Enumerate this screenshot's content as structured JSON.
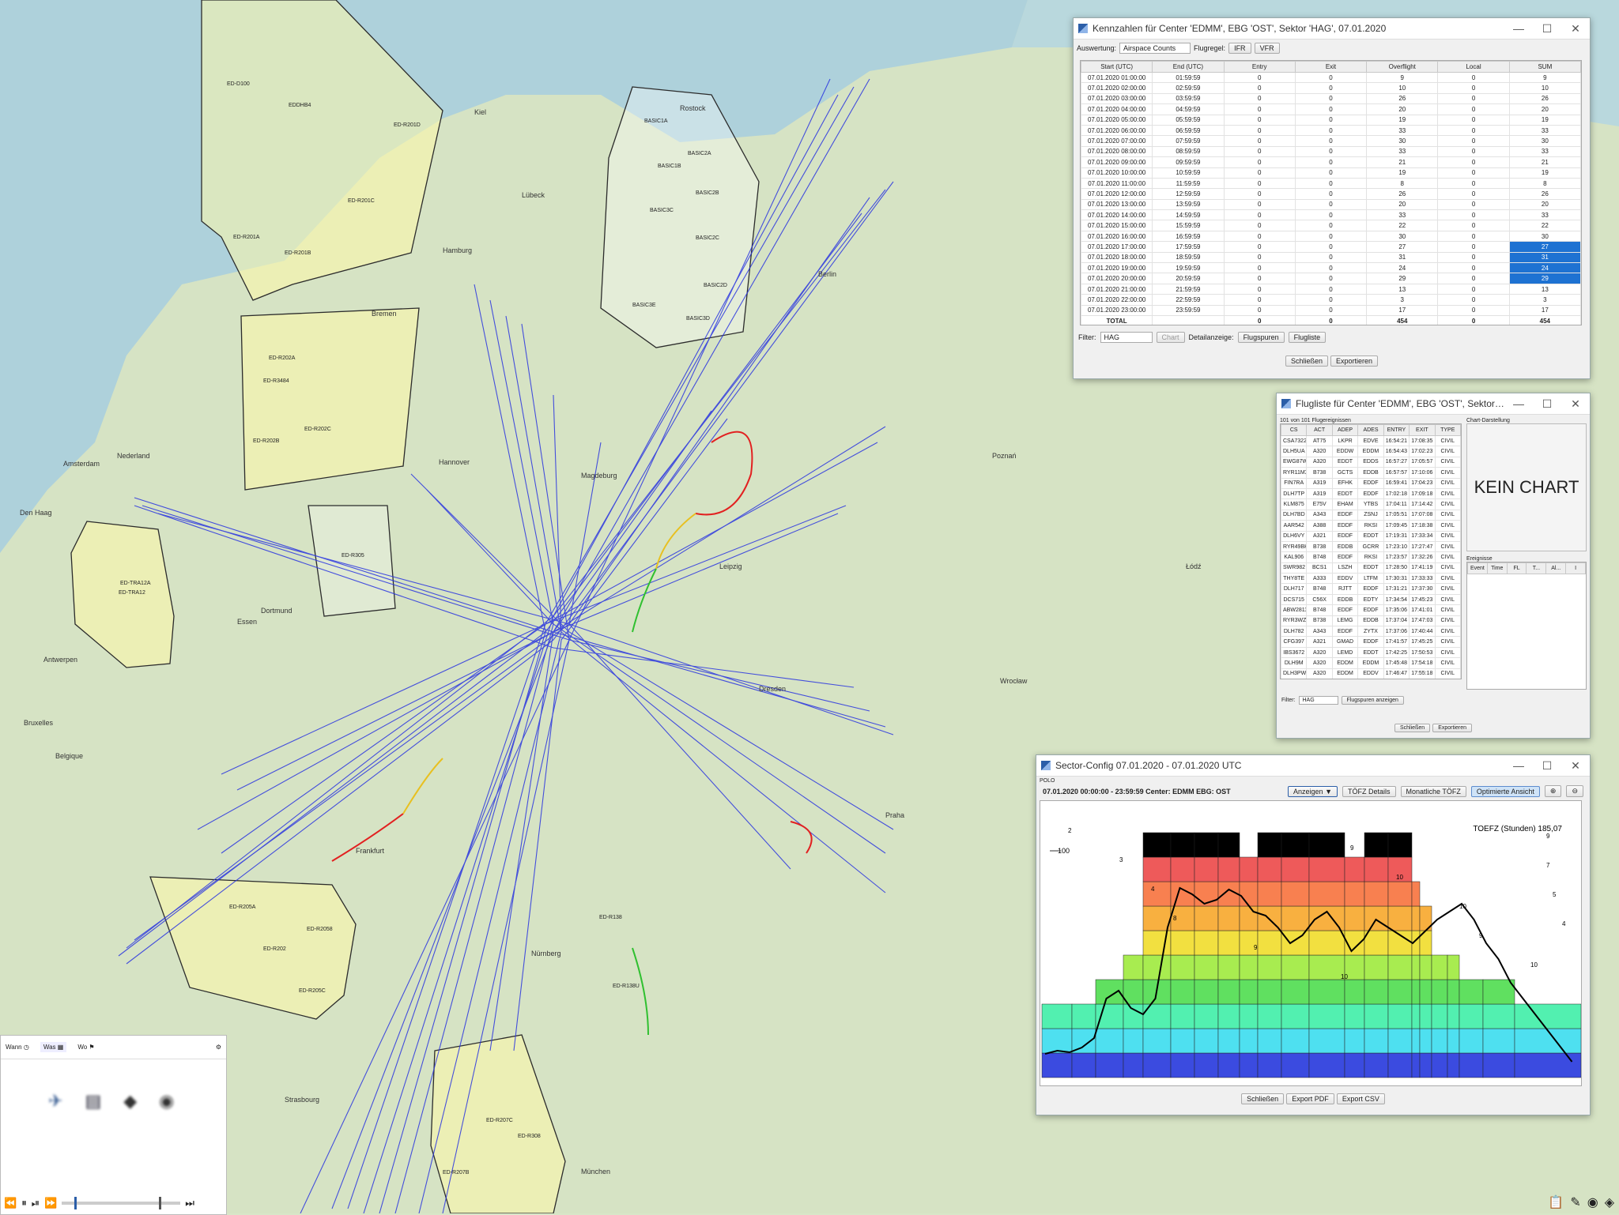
{
  "map": {
    "areas": [
      "ED-D100",
      "EDDHB4",
      "ED-R201D",
      "ED-R201C",
      "ED-R201A",
      "ED-R201B",
      "ED-R202A",
      "ED-R202C",
      "ED-R202B",
      "ED-R3484",
      "BASIC1A",
      "BASIC1B",
      "BASIC2A",
      "BASIC2B",
      "BASIC2C",
      "BASIC2D",
      "BASIC3C",
      "BASIC3E",
      "BASIC3D",
      "ED-TRA12A",
      "ED-TRA12",
      "ED-R205A",
      "ED-R205C",
      "ED-R202",
      "ED-R2058",
      "ED-R207C",
      "ED-R207B",
      "ED-R305",
      "ED-R138",
      "ED-R138U",
      "ED-R308"
    ],
    "cities": [
      "Amsterdam",
      "Den Haag",
      "Antwerpen",
      "Bruxelles",
      "Belgique",
      "Nederland",
      "Hamburg",
      "Hannover",
      "Magdeburg",
      "Dortmund",
      "Essen",
      "Frankfurt",
      "Nürnberg",
      "München",
      "Strasbourg",
      "Leipzig",
      "Dresden",
      "Berlin",
      "Poznań",
      "Wrocław",
      "Łódź",
      "Praha",
      "Kiel",
      "Bremen",
      "Rostock",
      "Lübeck"
    ]
  },
  "kennzahlen": {
    "title": "Kennzahlen für Center 'EDMM', EBG 'OST', Sektor 'HAG', 07.01.2020",
    "auswertung_label": "Auswertung:",
    "auswertung_value": "Airspace Counts",
    "flugregel_label": "Flugregel:",
    "ifr_button": "IFR",
    "vfr_button": "VFR",
    "columns": [
      "Start (UTC)",
      "End (UTC)",
      "Entry",
      "Exit",
      "Overflight",
      "Local",
      "SUM"
    ],
    "rows": [
      [
        "07.01.2020 01:00:00",
        "01:59:59",
        "0",
        "0",
        "9",
        "0",
        "9"
      ],
      [
        "07.01.2020 02:00:00",
        "02:59:59",
        "0",
        "0",
        "10",
        "0",
        "10"
      ],
      [
        "07.01.2020 03:00:00",
        "03:59:59",
        "0",
        "0",
        "26",
        "0",
        "26"
      ],
      [
        "07.01.2020 04:00:00",
        "04:59:59",
        "0",
        "0",
        "20",
        "0",
        "20"
      ],
      [
        "07.01.2020 05:00:00",
        "05:59:59",
        "0",
        "0",
        "19",
        "0",
        "19"
      ],
      [
        "07.01.2020 06:00:00",
        "06:59:59",
        "0",
        "0",
        "33",
        "0",
        "33"
      ],
      [
        "07.01.2020 07:00:00",
        "07:59:59",
        "0",
        "0",
        "30",
        "0",
        "30"
      ],
      [
        "07.01.2020 08:00:00",
        "08:59:59",
        "0",
        "0",
        "33",
        "0",
        "33"
      ],
      [
        "07.01.2020 09:00:00",
        "09:59:59",
        "0",
        "0",
        "21",
        "0",
        "21"
      ],
      [
        "07.01.2020 10:00:00",
        "10:59:59",
        "0",
        "0",
        "19",
        "0",
        "19"
      ],
      [
        "07.01.2020 11:00:00",
        "11:59:59",
        "0",
        "0",
        "8",
        "0",
        "8"
      ],
      [
        "07.01.2020 12:00:00",
        "12:59:59",
        "0",
        "0",
        "26",
        "0",
        "26"
      ],
      [
        "07.01.2020 13:00:00",
        "13:59:59",
        "0",
        "0",
        "20",
        "0",
        "20"
      ],
      [
        "07.01.2020 14:00:00",
        "14:59:59",
        "0",
        "0",
        "33",
        "0",
        "33"
      ],
      [
        "07.01.2020 15:00:00",
        "15:59:59",
        "0",
        "0",
        "22",
        "0",
        "22"
      ],
      [
        "07.01.2020 16:00:00",
        "16:59:59",
        "0",
        "0",
        "30",
        "0",
        "30"
      ],
      [
        "07.01.2020 17:00:00",
        "17:59:59",
        "0",
        "0",
        "27",
        "0",
        "27"
      ],
      [
        "07.01.2020 18:00:00",
        "18:59:59",
        "0",
        "0",
        "31",
        "0",
        "31"
      ],
      [
        "07.01.2020 19:00:00",
        "19:59:59",
        "0",
        "0",
        "24",
        "0",
        "24"
      ],
      [
        "07.01.2020 20:00:00",
        "20:59:59",
        "0",
        "0",
        "29",
        "0",
        "29"
      ],
      [
        "07.01.2020 21:00:00",
        "21:59:59",
        "0",
        "0",
        "13",
        "0",
        "13"
      ],
      [
        "07.01.2020 22:00:00",
        "22:59:59",
        "0",
        "0",
        "3",
        "0",
        "3"
      ],
      [
        "07.01.2020 23:00:00",
        "23:59:59",
        "0",
        "0",
        "17",
        "0",
        "17"
      ],
      [
        "TOTAL",
        "",
        "0",
        "0",
        "454",
        "0",
        "454"
      ]
    ],
    "highlighted_rows": [
      16,
      17,
      18,
      19
    ],
    "filter_label": "Filter:",
    "filter_value": "HAG",
    "chart_button": "Chart",
    "detail_label": "Detailanzeige:",
    "flugspuren_button": "Flugspuren",
    "flugliste_button": "Flugliste",
    "close_button": "Schließen",
    "export_button": "Exportieren"
  },
  "flugliste": {
    "title": "Flugliste für Center 'EDMM', EBG 'OST', Sektor 'HAG', 07.01.2...",
    "count_text": "101 von 101 Flugereignissen",
    "columns": [
      "CS",
      "ACT",
      "ADEP",
      "ADES",
      "ENTRY",
      "EXIT",
      "TYPE"
    ],
    "rows": [
      [
        "CSA7322",
        "AT75",
        "LKPR",
        "EDVE",
        "16:54:21",
        "17:08:35",
        "CIVIL"
      ],
      [
        "DLH5UA",
        "A320",
        "EDDW",
        "EDDM",
        "16:54:43",
        "17:02:23",
        "CIVIL"
      ],
      [
        "EWG87W",
        "A320",
        "EDDT",
        "EDDS",
        "16:57:27",
        "17:05:57",
        "CIVIL"
      ],
      [
        "RYR11MX",
        "B738",
        "GCTS",
        "EDDB",
        "16:57:57",
        "17:10:06",
        "CIVIL"
      ],
      [
        "FIN7RA",
        "A319",
        "EFHK",
        "EDDF",
        "16:59:41",
        "17:04:23",
        "CIVIL"
      ],
      [
        "DLH7TP",
        "A319",
        "EDDT",
        "EDDF",
        "17:02:18",
        "17:09:18",
        "CIVIL"
      ],
      [
        "KLM875",
        "E75V",
        "EHAM",
        "YTBS",
        "17:04:11",
        "17:14:42",
        "CIVIL"
      ],
      [
        "DLH7BD",
        "A343",
        "EDDF",
        "ZSNJ",
        "17:05:51",
        "17:07:08",
        "CIVIL"
      ],
      [
        "AAR542",
        "A388",
        "EDDF",
        "RKSI",
        "17:09:45",
        "17:18:38",
        "CIVIL"
      ],
      [
        "DLH6VY",
        "A321",
        "EDDF",
        "EDDT",
        "17:19:31",
        "17:33:34",
        "CIVIL"
      ],
      [
        "RYR49BH",
        "B738",
        "EDDB",
        "GCRR",
        "17:23:10",
        "17:27:47",
        "CIVIL"
      ],
      [
        "KAL906",
        "B748",
        "EDDF",
        "RKSI",
        "17:23:57",
        "17:32:26",
        "CIVIL"
      ],
      [
        "SWR982",
        "BCS1",
        "LSZH",
        "EDDT",
        "17:28:50",
        "17:41:19",
        "CIVIL"
      ],
      [
        "THY8TE",
        "A333",
        "EDDV",
        "LTFM",
        "17:30:31",
        "17:33:33",
        "CIVIL"
      ],
      [
        "DLH717",
        "B748",
        "RJTT",
        "EDDF",
        "17:31:21",
        "17:37:30",
        "CIVIL"
      ],
      [
        "DCS715",
        "C56X",
        "EDDB",
        "EDTY",
        "17:34:54",
        "17:45:23",
        "CIVIL"
      ],
      [
        "ABW2811",
        "B748",
        "EDDF",
        "EDDF",
        "17:35:06",
        "17:41:01",
        "CIVIL"
      ],
      [
        "RYR3WZ",
        "B738",
        "LEMG",
        "EDDB",
        "17:37:04",
        "17:47:03",
        "CIVIL"
      ],
      [
        "DLH782",
        "A343",
        "EDDF",
        "ZYTX",
        "17:37:06",
        "17:40:44",
        "CIVIL"
      ],
      [
        "CFG397",
        "A321",
        "GMAD",
        "EDDF",
        "17:41:57",
        "17:45:25",
        "CIVIL"
      ],
      [
        "IBS3672",
        "A320",
        "LEMD",
        "EDDT",
        "17:42:25",
        "17:50:53",
        "CIVIL"
      ],
      [
        "DLH9M",
        "A320",
        "EDDM",
        "EDDM",
        "17:45:48",
        "17:54:18",
        "CIVIL"
      ],
      [
        "DLH3PW",
        "A320",
        "EDDM",
        "EDDV",
        "17:46:47",
        "17:55:18",
        "CIVIL"
      ]
    ],
    "chart_group_label": "Chart-Darstellung",
    "kein_chart": "KEIN CHART",
    "ereignisse_label": "Ereignisse",
    "event_columns": [
      "Event",
      "Time",
      "FL",
      "T...",
      "Al...",
      "I"
    ],
    "filter_label": "Filter:",
    "filter_value": "HAG",
    "flugspuren_button": "Flugspuren anzeigen",
    "close_button": "Schließen",
    "export_button": "Exportieren"
  },
  "sector": {
    "title": "Sector-Config 07.01.2020 - 07.01.2020 UTC",
    "polo": "POLO",
    "info": "07.01.2020 00:00:00 - 23:59:59 Center: EDMM EBG: OST",
    "anzeigen_button": "Anzeigen",
    "toefz_details_button": "TÖFZ Details",
    "monatliche_button": "Monatliche TÖFZ",
    "optimierte_button": "Optimierte Ansicht",
    "toefz_label": "TOEFZ (Stunden) 185,07",
    "y_tick": "100",
    "close_button": "Schließen",
    "export_pdf_button": "Export PDF",
    "export_csv_button": "Export CSV",
    "config_counts": [
      "2",
      "3",
      "4",
      "8",
      "9",
      "10",
      "9",
      "10",
      "10",
      "9",
      "10",
      "9",
      "7",
      "5",
      "4"
    ]
  },
  "bottom_panel": {
    "wann_label": "Wann",
    "was_label": "Was",
    "wo_label": "Wo"
  },
  "colors": {
    "track_blue": "#2a35e0",
    "highlight": "#1e72d2",
    "accent_red": "#e23030"
  }
}
